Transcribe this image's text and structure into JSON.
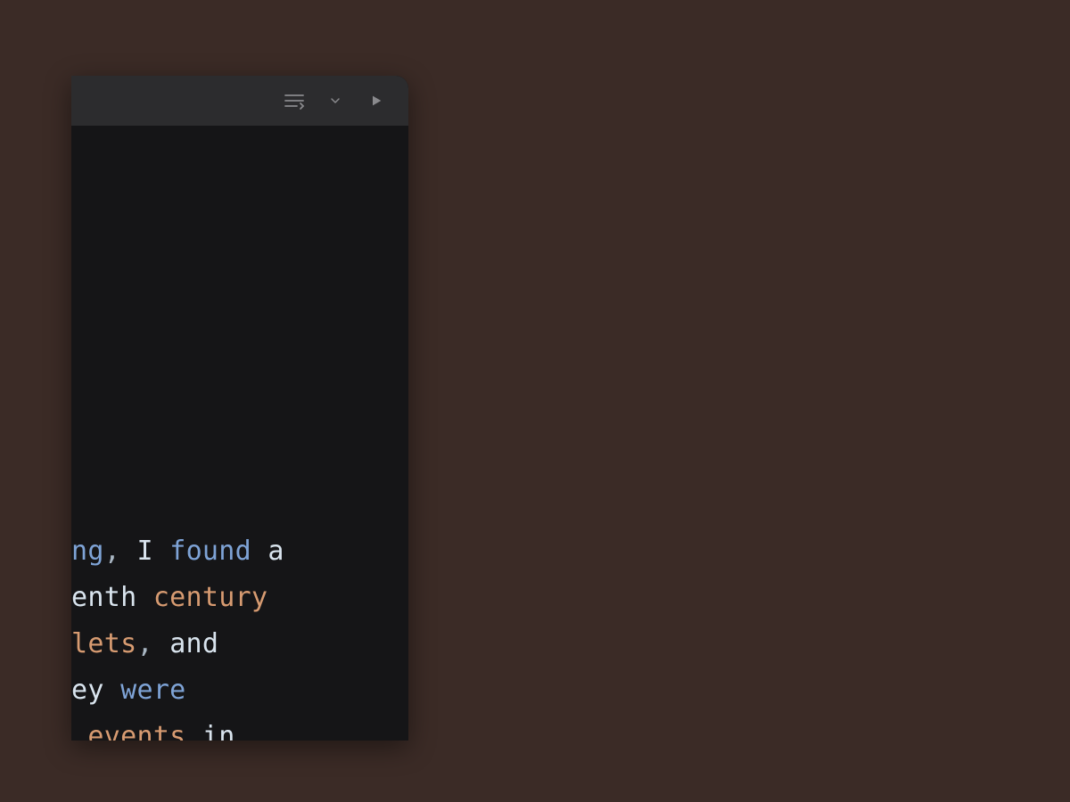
{
  "toolbar": {
    "icons": {
      "wrap": "word-wrap-icon",
      "chevron": "chevron-down-icon",
      "play": "play-icon"
    }
  },
  "editor": {
    "lines": [
      [
        {
          "t": "ng",
          "c": "blue"
        },
        {
          "t": ",",
          "c": "punct"
        },
        {
          "t": " I ",
          "c": "default"
        },
        {
          "t": "found",
          "c": "blue"
        },
        {
          "t": " a",
          "c": "default"
        }
      ],
      [
        {
          "t": "enth ",
          "c": "default"
        },
        {
          "t": "century",
          "c": "orange"
        }
      ],
      [
        {
          "t": "lets",
          "c": "orange"
        },
        {
          "t": ",",
          "c": "punct"
        },
        {
          "t": " and",
          "c": "default"
        }
      ],
      [
        {
          "t": "ey ",
          "c": "default"
        },
        {
          "t": "were",
          "c": "blue"
        }
      ],
      [
        {
          "t": " ",
          "c": "default"
        },
        {
          "t": "events",
          "c": "orange"
        },
        {
          "t": " in",
          "c": "default"
        }
      ]
    ]
  }
}
